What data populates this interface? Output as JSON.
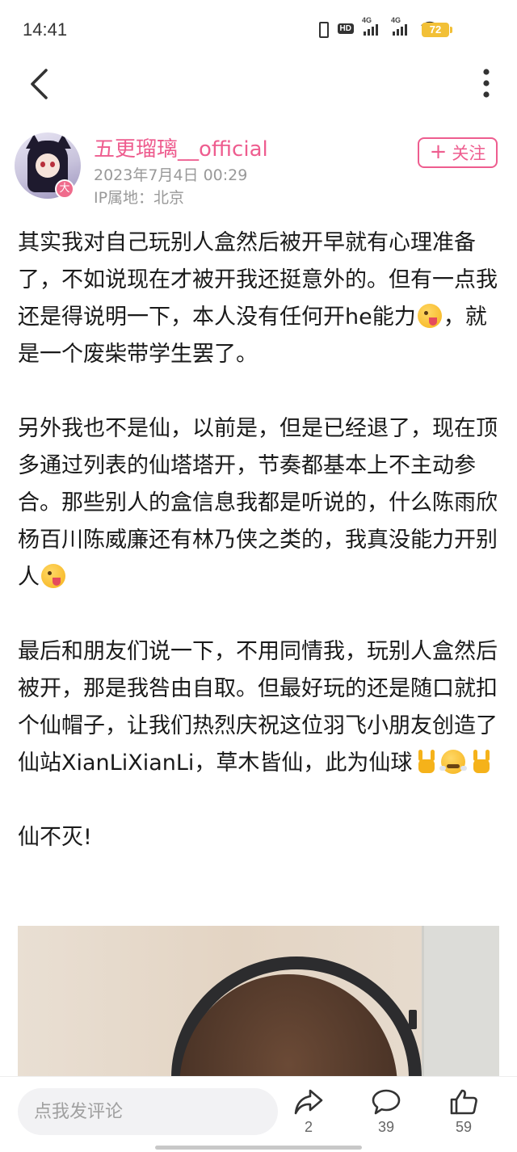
{
  "status_bar": {
    "time": "14:41",
    "hd_label": "HD",
    "signal_1_label": "4G",
    "signal_2_label": "4G",
    "battery": "72"
  },
  "nav": {
    "back_icon": "chevron-left-icon",
    "more_icon": "more-vertical-icon"
  },
  "author": {
    "name": "五更瑠璃__official",
    "date": "2023年7月4日 00:29",
    "ip_location": "IP属地：北京",
    "badge": "大",
    "follow_plus": "+",
    "follow_label": "关注"
  },
  "post": {
    "p1": {
      "a": "其实我对自己玩别人盒然后被开早就有心理准备了，不如说现在才被开我还挺意外的。但有一点我还是得说明一下，本人没有任何开he能力",
      "b": "，就是一个废柴带学生罢了。"
    },
    "p2": {
      "a": "另外我也不是仙，以前是，但是已经退了，现在顶多通过列表的仙塔塔开，节奏都基本上不主动参合。那些别人的盒信息我都是听说的，什么陈雨欣杨百川陈威廉还有林乃侠之类的，我真没能力开别人"
    },
    "p3": {
      "a": "最后和朋友们说一下，不用同情我，玩别人盒然后被开，那是我咎由自取。但最好玩的还是随口就扣个仙帽子，让我们热烈庆祝这位羽飞小朋友创造了仙站XianLiXianLi，草木皆仙，此为仙球"
    },
    "p4": "仙不灭!",
    "emojis": [
      "zany-face-emoji",
      "sign-of-horns-emoji",
      "face-with-steam-emoji"
    ]
  },
  "bottom_bar": {
    "comment_placeholder": "点我发评论",
    "share_count": "2",
    "comment_count": "39",
    "like_count": "59"
  },
  "colors": {
    "accent": "#ee5d8f",
    "muted_text": "#999999",
    "battery": "#f2c037"
  }
}
